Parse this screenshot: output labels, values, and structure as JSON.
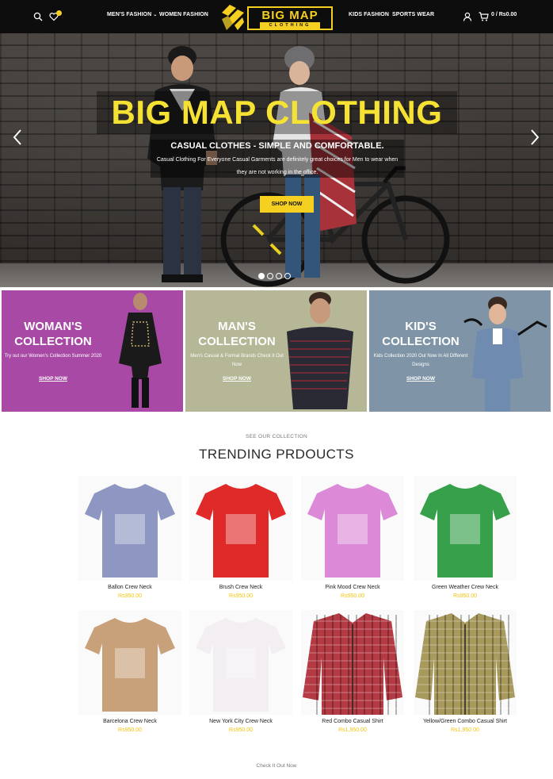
{
  "header": {
    "nav_left": [
      "MEN'S FASHION",
      "WOMEN FASHION"
    ],
    "nav_right": [
      "KIDS FASHION",
      "SPORTS WEAR"
    ],
    "logo_title": "BIG MAP",
    "logo_subtitle": "CLOTHING",
    "cart_text": "0 / Rs0.00",
    "icons": [
      "search-icon",
      "heart-icon",
      "user-icon",
      "cart-icon"
    ],
    "accent_color": "#f5d020"
  },
  "hero": {
    "title": "BIG MAP CLOTHING",
    "subtitle": "CASUAL CLOTHES - SIMPLE AND COMFORTABLE.",
    "description": "Casual Clothing For Everyone Casual Garments are definitely great choices for Men to wear when they are not working in the office.",
    "button_label": "SHOP NOW",
    "slides_count": 4,
    "active_slide": 1
  },
  "collections": [
    {
      "title": "WOMAN'S COLLECTION",
      "description": "Try out our Women's Collection Summer 2020",
      "link": "SHOP NOW",
      "color": "#a84aa5"
    },
    {
      "title": "MAN'S COLLECTION",
      "description": "Men's Casual & Formal Brands Check it Out Now",
      "link": "SHOP NOW",
      "color": "#b5b796"
    },
    {
      "title": "KID'S COLLECTION",
      "description": "Kids Collection 2020 Out Now In All Different Designs",
      "link": "SHOP NOW",
      "color": "#7f94a6"
    }
  ],
  "trending": {
    "eyebrow": "SEE OUR COLLECTION",
    "title": "TRENDING PRDOUCTS",
    "products": [
      {
        "name": "Ballon Crew Neck",
        "price": "Rs950.00",
        "color": "#8d97c2"
      },
      {
        "name": "Brush Crew Neck",
        "price": "Rs950.00",
        "color": "#e02a2a"
      },
      {
        "name": "Pink Mood Crew Neck",
        "price": "Rs950.00",
        "color": "#dc8ad8"
      },
      {
        "name": "Green Weather Crew Neck",
        "price": "Rs950.00",
        "color": "#36a04a"
      },
      {
        "name": "Barcelona Crew Neck",
        "price": "Rs950.00",
        "color": "#c8a07a"
      },
      {
        "name": "New York City Crew Neck",
        "price": "Rs950.00",
        "color": "#f2eef2"
      },
      {
        "name": "Red Combo Casual Shirt",
        "price": "Rs1,950.00",
        "color": "#b43a44"
      },
      {
        "name": "Yellow/Green Combo Casual Shirt",
        "price": "Rs1,950.00",
        "color": "#a89a5c"
      }
    ]
  },
  "footer_hint": "Check It Out Now"
}
